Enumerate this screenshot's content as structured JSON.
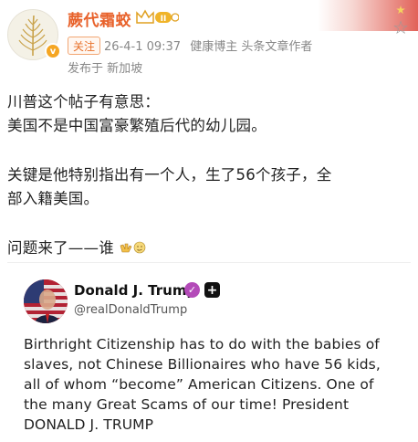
{
  "header": {
    "username": "蕨代霜蛟",
    "level_badge": "II",
    "follow_label": "关注",
    "timestamp": "26-4-1 09:37",
    "tags": "健康博主 头条文章作者",
    "location": "发布于 新加坡",
    "verify_mark": "v"
  },
  "post": {
    "line1": "川普这个帖子有意思：",
    "line2": "美国不是中国富豪繁殖后代的幼儿园。",
    "line3": "关键是他特别指出有一个人，生了56个孩子，全",
    "line4": "部入籍美国。",
    "line5": "问题来了——谁"
  },
  "quoted": {
    "name": "Donald J. Trump",
    "handle": "@realDonaldTrump",
    "plus": "+",
    "lines": [
      "Birthright Citizenship has to do with the babies of",
      "slaves, not Chinese Billionaires who have 56 kids,",
      "all of whom “become” American Citizens. One of",
      "the many Great Scams of our time! President",
      "DONALD J. TRUMP"
    ]
  },
  "colors": {
    "username": "#e8612a",
    "verified": "#b34ab8"
  },
  "icons": {
    "favorite": "star-outline-icon",
    "crown": "crown-icon"
  }
}
